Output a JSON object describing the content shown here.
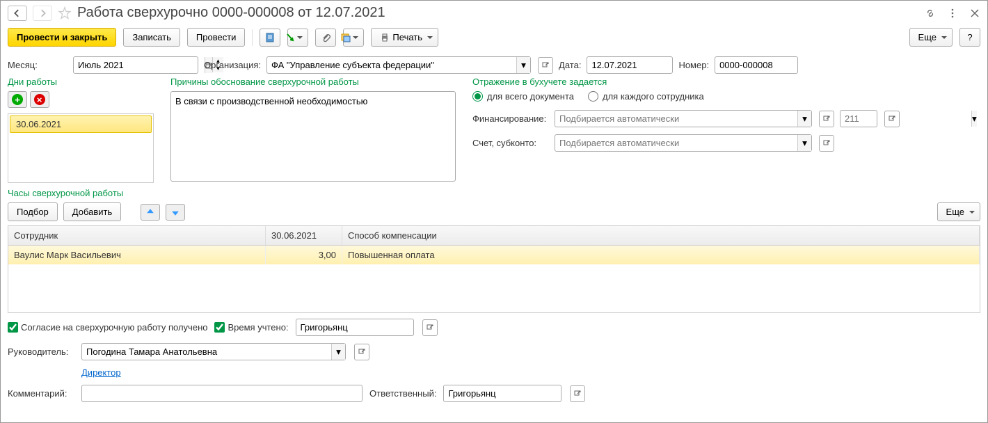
{
  "title": "Работа сверхурочно 0000-000008 от 12.07.2021",
  "toolbar": {
    "post_close": "Провести и закрыть",
    "save": "Записать",
    "post": "Провести",
    "print": "Печать",
    "more": "Еще"
  },
  "form": {
    "month_label": "Месяц:",
    "month_value": "Июль 2021",
    "org_label": "Организация:",
    "org_value": "ФА \"Управление субъекта федерации\"",
    "date_label": "Дата:",
    "date_value": "12.07.2021",
    "number_label": "Номер:",
    "number_value": "0000-000008"
  },
  "sections": {
    "days_title": "Дни работы",
    "reason_title": "Причины обоснование сверхурочной работы",
    "reason_value": "В связи с производственной необходимостью",
    "reflect_title": "Отражение в бухучете задается",
    "reflect_opt1": "для всего документа",
    "reflect_opt2": "для каждого сотрудника",
    "financing_label": "Финансирование:",
    "financing_ph": "Подбирается автоматически",
    "account_label": "Счет, субконто:",
    "account_ph": "Подбирается автоматически",
    "account2_ph": "211"
  },
  "dates": [
    "30.06.2021"
  ],
  "hours_title": "Часы сверхурочной работы",
  "table": {
    "btn_pick": "Подбор",
    "btn_add": "Добавить",
    "col_employee": "Сотрудник",
    "col_date": "30.06.2021",
    "col_comp": "Способ компенсации",
    "rows": [
      {
        "employee": "Ваулис Марк Васильевич",
        "hours": "3,00",
        "comp": "Повышенная оплата"
      }
    ]
  },
  "footer": {
    "consent": "Согласие на сверхурочную работу получено",
    "time_label": "Время учтено:",
    "time_value": "Григорьянц",
    "manager_label": "Руководитель:",
    "manager_value": "Погодина Тамара Анатольевна",
    "manager_role": "Директор",
    "comment_label": "Комментарий:",
    "resp_label": "Ответственный:",
    "resp_value": "Григорьянц"
  }
}
